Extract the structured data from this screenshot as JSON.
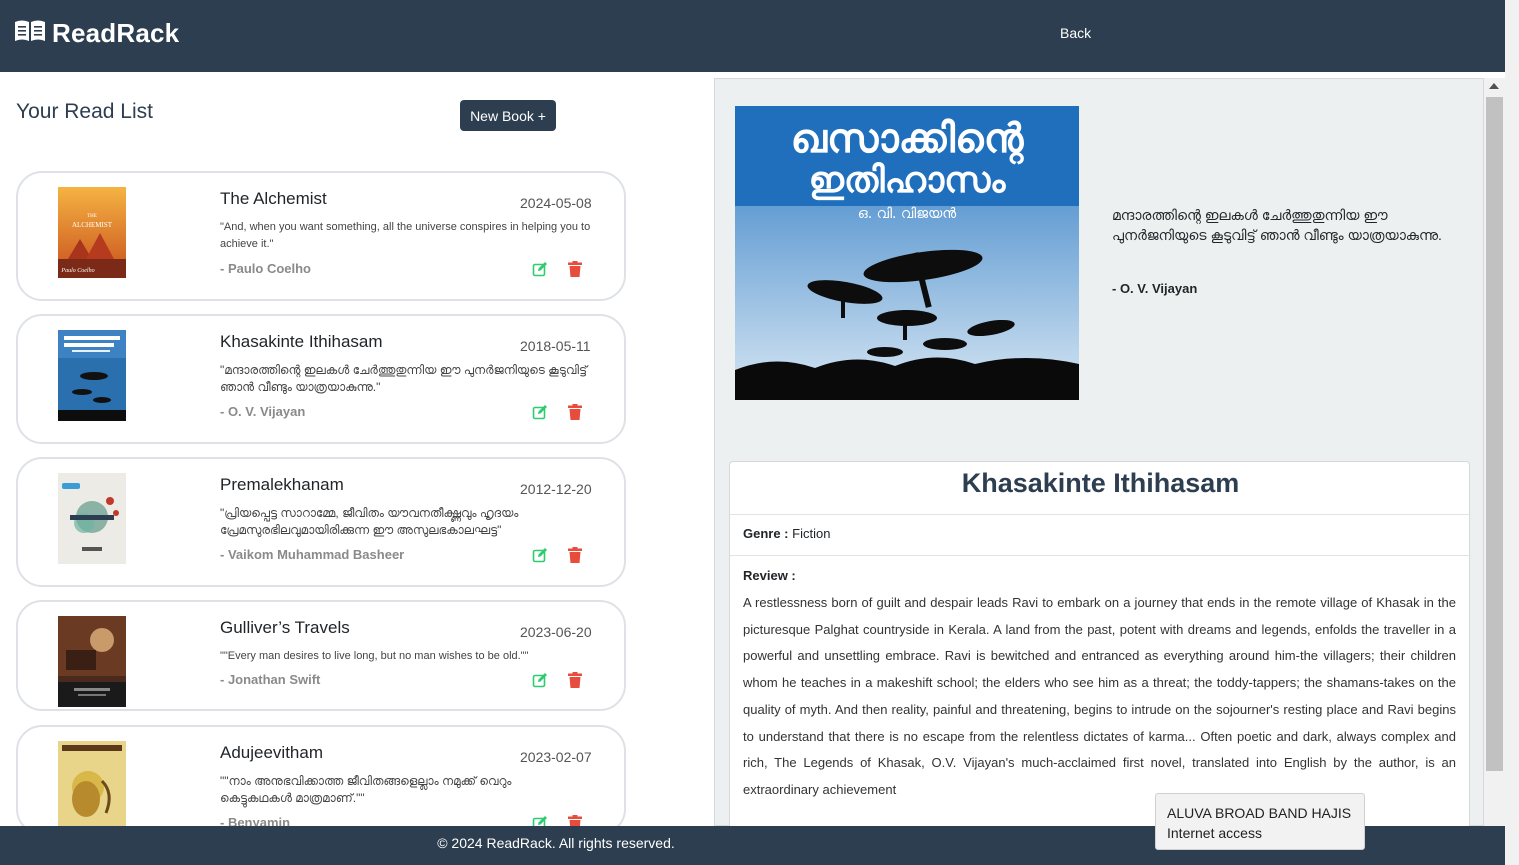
{
  "navbar": {
    "brand": "ReadRack",
    "back_label": "Back"
  },
  "list": {
    "title": "Your Read List",
    "new_book_label": "New Book +",
    "books": [
      {
        "title": "The Alchemist",
        "date": "2024-05-08",
        "quote": "\"And, when you want something, all the universe conspires in helping you to achieve it.\"",
        "author": "- Paulo Coelho",
        "cover": {
          "text_top": "THE",
          "text_mid": "ALCHEMIST",
          "text_bottom": "Paulo Coelho",
          "color": "#e69a2a"
        }
      },
      {
        "title": "Khasakinte Ithihasam",
        "date": "2018-05-11",
        "quote": "\"മന്ദാരത്തിന്റെ ഇലകൾ ചേർത്തുതുന്നിയ ഈ പുനർജനിയുടെ കൂടുവിട്ട് ഞാൻ വീണ്ടും യാത്രയാകുന്നു.\"",
        "author": "- O. V. Vijayan",
        "cover": {
          "color": "#2a6fae"
        }
      },
      {
        "title": "Premalekhanam",
        "date": "2012-12-20",
        "quote": "\"പ്രിയപ്പെട്ട സാറാമ്മേ, ജീവിതം യൗവനതീക്ഷ്ണവും ഹൃദയം പ്രേമസുരഭിലവുമായിരിക്കുന്ന ഈ അസുലഭകാലഘട്ട\"",
        "author": "- Vaikom Muhammad Basheer",
        "cover": {
          "color": "#ecebe6"
        }
      },
      {
        "title": "Gulliver’s Travels",
        "date": "2023-06-20",
        "quote": "\"\"Every man desires to live long, but no man wishes to be old.\"\"",
        "author": "- Jonathan Swift",
        "cover": {
          "color": "#4a2a1c"
        }
      },
      {
        "title": "Adujeevitham",
        "date": "2023-02-07",
        "quote": "\"\"നാം അനുഭവിക്കാത്ത ജീവിതങ്ങളെല്ലാം നമുക്ക് വെറും കെട്ടുകഥകൾ മാത്രമാണ്.\"\"",
        "author": "- Benyamin",
        "cover": {
          "color": "#d9b84a"
        }
      }
    ]
  },
  "detail": {
    "quote": "മന്ദാരത്തിന്റെ ഇലകൾ ചേർത്തുതുന്നിയ ഈ പുനർജനിയുടെ കൂടുവിട്ട് ഞാൻ വീണ്ടും യാത്രയാകുന്നു.",
    "author": "- O. V. Vijayan",
    "title": "Khasakinte Ithihasam",
    "genre_label": "Genre :",
    "genre": "Fiction",
    "review_label": "Review :",
    "review": "A restlessness born of guilt and despair leads Ravi to embark on a journey that ends in the remote village of Khasak in the picturesque Palghat countryside in Kerala. A land from the past, potent with dreams and legends, enfolds the traveller in a powerful and unsettling embrace. Ravi is bewitched and entranced as everything around him-the villagers; their children whom he teaches in a makeshift school; the elders who see him as a threat; the toddy-tappers; the shamans-takes on the quality of myth. And then reality, painful and threatening, begins to intrude on the sojourner's resting place and Ravi begins to understand that there is no escape from the relentless dictates of karma... Often poetic and dark, always complex and rich, The Legends of Khasak, O.V. Vijayan's much-acclaimed first novel, translated into English by the author, is an extraordinary achievement",
    "cover": {
      "title_line1": "ഖസാക്കിന്റെ",
      "title_line2": "ഇതിഹാസം",
      "author": "ഒ. വി. വിജയൻ"
    }
  },
  "footer": {
    "text": "© 2024 ReadRack. All rights reserved."
  },
  "toast": {
    "line1": "ALUVA BROAD BAND HAJIS",
    "line2": "Internet access"
  },
  "colors": {
    "navbar": "#2c3e50",
    "edit": "#2ecc71",
    "delete": "#e74c3c",
    "panel": "#ecf0f1"
  }
}
